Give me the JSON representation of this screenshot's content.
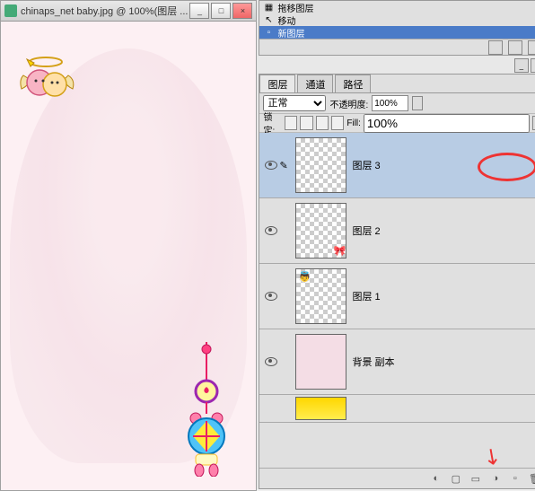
{
  "window": {
    "title": "chinaps_net baby.jpg @ 100%(图层 ...",
    "minimize": "_",
    "maximize": "□",
    "close": "×"
  },
  "history": {
    "items": [
      {
        "label": "拖移图层"
      },
      {
        "label": "移动"
      },
      {
        "label": "新图层"
      }
    ]
  },
  "layers_panel": {
    "tabs": [
      "图层",
      "通道",
      "路径"
    ],
    "blend_mode": "正常",
    "opacity_label": "不透明度:",
    "opacity_value": "100%",
    "lock_label": "锁定:",
    "fill_label": "Fill:",
    "fill_value": "100%",
    "layers": [
      {
        "name": "图层 3",
        "selected": true,
        "thumb": "checker"
      },
      {
        "name": "图层 2",
        "selected": false,
        "thumb": "checker"
      },
      {
        "name": "图层 1",
        "selected": false,
        "thumb": "checker"
      },
      {
        "name": "背景 副本",
        "selected": false,
        "thumb": "image"
      }
    ]
  }
}
